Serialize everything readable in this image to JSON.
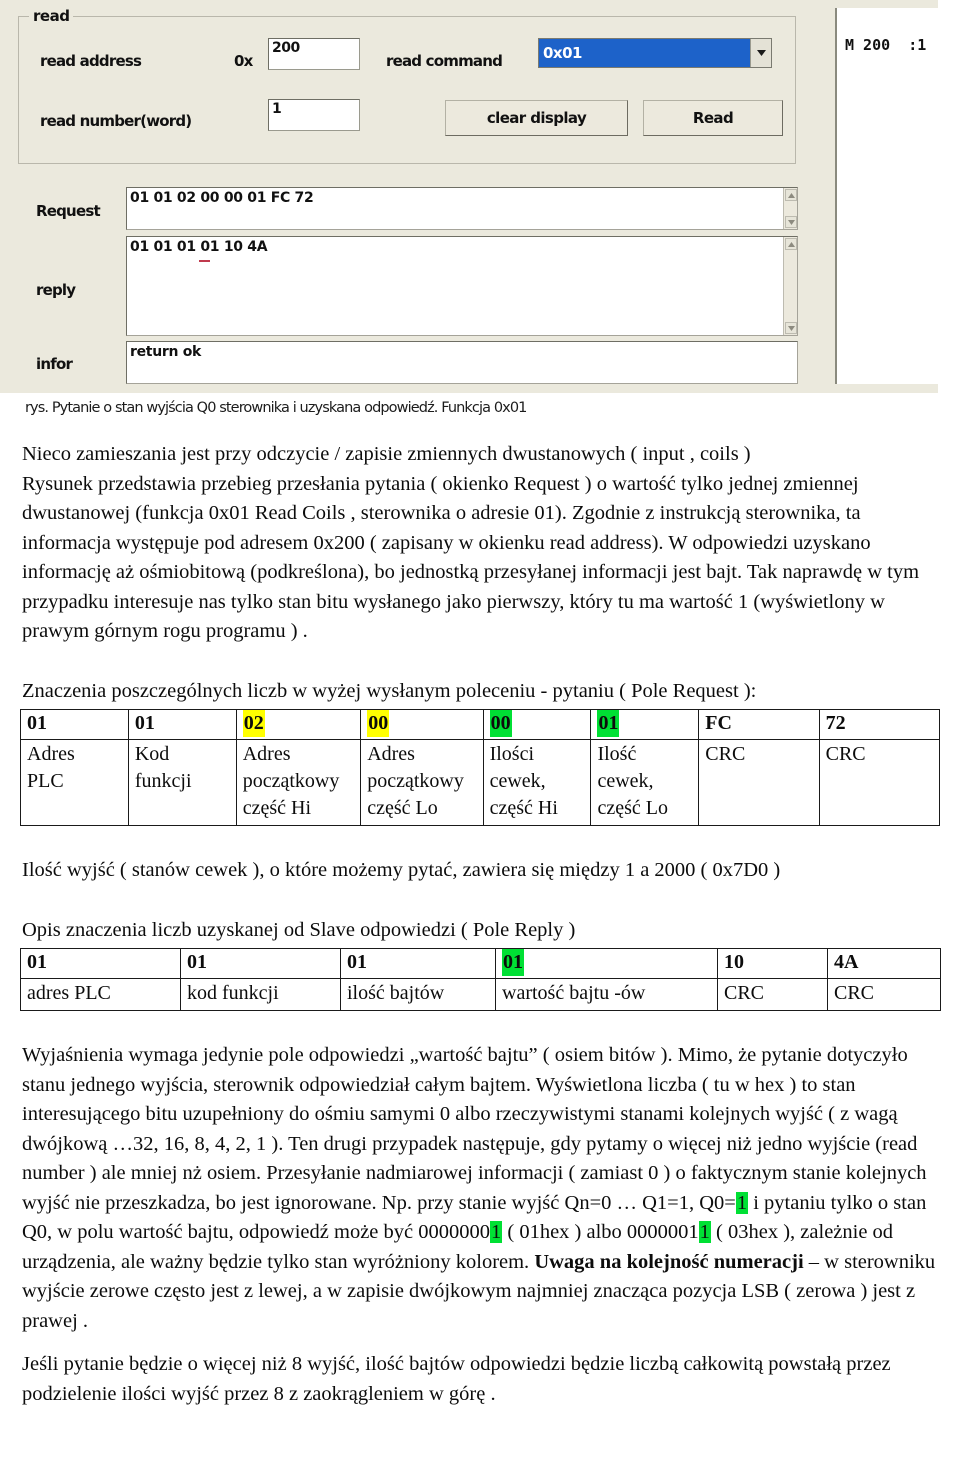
{
  "screenshot": {
    "group_legend": "read",
    "labels": {
      "read_address": "read address",
      "hex_prefix": "0x",
      "read_command": "read command",
      "read_number": "read number(word)",
      "request": "Request",
      "reply": "reply",
      "infor": "infor"
    },
    "inputs": {
      "read_address_value": "200",
      "read_number_value": "1",
      "read_command_selected": "0x01"
    },
    "buttons": {
      "clear_display": "clear display",
      "read": "Read"
    },
    "fields": {
      "request_value": "01 01 02 00 00 01 FC 72",
      "reply_value": "01 01 01 01 10 4A",
      "infor_value": "return ok"
    },
    "display_panel": {
      "value": "M 200  :1"
    },
    "caption": "rys. Pytanie o stan wyjścia Q0 sterownika i uzyskana odpowiedź. Funkcja 0x01"
  },
  "body": {
    "para1": "Nieco zamieszania jest przy odczycie / zapisie zmiennych dwustanowych ( input , coils )",
    "para2": "Rysunek przedstawia przebieg przesłania pytania ( okienko Request ) o wartość tylko jednej zmiennej dwustanowej  (funkcja 0x01 Read Coils , sterownika o adresie 01). Zgodnie z instrukcją sterownika, ta informacja występuje pod adresem 0x200 ( zapisany w okienku read address). W odpowiedzi uzyskano  informację  aż ośmiobitową  (podkreślona),  bo jednostką przesyłanej informacji jest bajt. Tak naprawdę w tym przypadku  interesuje nas tylko stan bitu wysłanego jako pierwszy,  który tu ma  wartość 1 (wyświetlony w  prawym górnym rogu programu ) .",
    "request_table_title": "Znaczenia poszczególnych liczb w wyżej wysłanym poleceniu - pytaniu ( Pole Request ):",
    "note_quantity": "Ilość wyjść ( stanów cewek ), o które możemy pytać, zawiera się między 1 a 2000 ( 0x7D0 )",
    "reply_table_title": "Opis znaczenia liczb uzyskanej od Slave odpowiedzi ( Pole Reply )",
    "para3_a": "Wyjaśnienia wymaga jedynie pole odpowiedzi „wartość bajtu” ( osiem bitów ). Mimo, że pytanie dotyczyło stanu jednego wyjścia, sterownik odpowiedział  całym bajtem. Wyświetlona liczba ( tu w hex )  to stan interesującego bitu uzupełniony do ośmiu samymi 0 albo rzeczywistymi stanami kolejnych wyjść (  z wagą dwójkową  …32, 16, 8, 4, 2, 1 ). Ten drugi przypadek następuje, gdy pytamy o więcej niż jedno wyjście (read number ) ale mniej nż osiem. Przesyłanie nadmiarowej informacji  ( zamiast 0 ) o faktycznym stanie kolejnych wyjść  nie przeszkadza, bo jest ignorowane. Np. przy stanie wyjść  Qn=0 … Q1=1, Q0=",
    "para3_hl1": "1",
    "para3_b": "  i pytaniu tylko o stan  Q0, w polu wartość bajtu, odpowiedź może być 0000000",
    "para3_hl2": "1",
    "para3_c": " ( 01hex ) albo 0000001",
    "para3_hl3": "1",
    "para3_d": " ( 03hex ), zależnie od urządzenia, ale ważny będzie tylko stan wyróżniony kolorem. ",
    "para3_bold": "Uwaga na kolejność numeracji",
    "para3_e": " – w sterowniku wyjście zerowe często jest z lewej, a w zapisie dwójkowym najmniej znacząca pozycja LSB ( zerowa ) jest z  prawej .",
    "para4": "Jeśli pytanie będzie o więcej niż 8 wyjść, ilość bajtów odpowiedzi będzie liczbą całkowitą powstałą przez podzielenie ilości wyjść przez  8 z zaokrągleniem w górę ."
  },
  "request_table": {
    "hex": [
      {
        "v": "01",
        "hl": "none"
      },
      {
        "v": "01",
        "hl": "none"
      },
      {
        "v": "02",
        "hl": "yellow"
      },
      {
        "v": "00",
        "hl": "yellow"
      },
      {
        "v": "00",
        "hl": "green"
      },
      {
        "v": "01",
        "hl": "green"
      },
      {
        "v": "FC",
        "hl": "none"
      },
      {
        "v": "72",
        "hl": "none"
      }
    ],
    "desc": [
      "Adres\nPLC",
      "Kod\nfunkcji",
      "Adres\npoczątkowy\nczęść Hi",
      "Adres\npoczątkowy\nczęść Lo",
      "Ilości\ncewek,\nczęść Hi",
      "Ilość\ncewek,\nczęść Lo",
      "CRC",
      "CRC"
    ]
  },
  "reply_table": {
    "hex": [
      {
        "v": "01",
        "hl": "none"
      },
      {
        "v": "01",
        "hl": "none"
      },
      {
        "v": "01",
        "hl": "none"
      },
      {
        "v": "01",
        "hl": "green"
      },
      {
        "v": "10",
        "hl": "none"
      },
      {
        "v": "4A",
        "hl": "none"
      }
    ],
    "desc": [
      "adres PLC",
      "kod funkcji",
      "ilość bajtów",
      "wartość bajtu -ów",
      "CRC",
      "CRC"
    ]
  },
  "colors": {
    "highlight_yellow": "#ffff00",
    "highlight_green": "#00e034",
    "combo_selection": "#1d62c9",
    "app_background": "#ebe9dd",
    "red_underline": "#c03a4e"
  }
}
